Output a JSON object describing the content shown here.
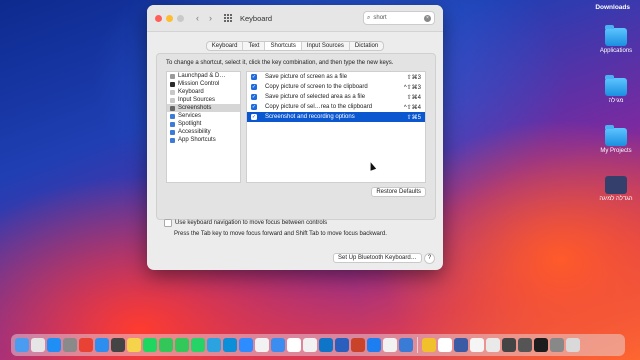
{
  "desktop": {
    "downloads_label": "Downloads",
    "icons": [
      {
        "label": "Applications",
        "color": "#4fb0ff"
      },
      {
        "label": "מגילה",
        "color": "#4fb0ff"
      },
      {
        "label": "My Projects",
        "color": "#4fb0ff"
      },
      {
        "label": "הגדלה למיגה",
        "color": "#34406b"
      }
    ]
  },
  "window": {
    "title": "Keyboard",
    "search_value": "short",
    "tabs": [
      {
        "label": "Keyboard",
        "active": false
      },
      {
        "label": "Text",
        "active": false
      },
      {
        "label": "Shortcuts",
        "active": true
      },
      {
        "label": "Input Sources",
        "active": false
      },
      {
        "label": "Dictation",
        "active": false
      }
    ],
    "instruction": "To change a shortcut, select it, click the key combination, and then type the new keys.",
    "categories": [
      {
        "label": "Launchpad & D…",
        "selected": false,
        "icon_color": "#9a9a9a"
      },
      {
        "label": "Mission Control",
        "selected": false,
        "icon_color": "#2b2b2b"
      },
      {
        "label": "Keyboard",
        "selected": false,
        "icon_color": "#c8c8c8"
      },
      {
        "label": "Input Sources",
        "selected": false,
        "icon_color": "#c8c8c8"
      },
      {
        "label": "Screenshots",
        "selected": true,
        "icon_color": "#666666"
      },
      {
        "label": "Services",
        "selected": false,
        "icon_color": "#3e7bd8"
      },
      {
        "label": "Spotlight",
        "selected": false,
        "icon_color": "#3e7bd8"
      },
      {
        "label": "Accessibility",
        "selected": false,
        "icon_color": "#3e7bd8"
      },
      {
        "label": "App Shortcuts",
        "selected": false,
        "icon_color": "#3e7bd8"
      }
    ],
    "shortcuts": [
      {
        "label": "Save picture of screen as a file",
        "keys": "⇧⌘3",
        "checked": true,
        "selected": false
      },
      {
        "label": "Copy picture of screen to the clipboard",
        "keys": "^⇧⌘3",
        "checked": true,
        "selected": false
      },
      {
        "label": "Save picture of selected area as a file",
        "keys": "⇧⌘4",
        "checked": true,
        "selected": false
      },
      {
        "label": "Copy picture of sel…rea to the clipboard",
        "keys": "^⇧⌘4",
        "checked": true,
        "selected": false
      },
      {
        "label": "Screenshot and recording options",
        "keys": "⇧⌘5",
        "checked": true,
        "selected": true
      }
    ],
    "restore_defaults_label": "Restore Defaults",
    "keyboard_nav_label": "Use keyboard navigation to move focus between controls",
    "keyboard_nav_hint": "Press the Tab key to move focus forward and Shift Tab to move focus backward.",
    "bluetooth_label": "Set Up Bluetooth Keyboard…",
    "help_label": "?"
  },
  "dock": {
    "apps": [
      "Finder",
      "Launchpad",
      "App Store",
      "System Preferences",
      "Chrome",
      "Safari",
      "Calculator",
      "Notes",
      "Spotify",
      "FaceTime",
      "Messages",
      "WhatsApp",
      "Telegram",
      "Skype",
      "Zoom",
      "Photos",
      "Mail",
      "Calendar",
      "Reminders",
      "VS Code",
      "Word",
      "PowerPoint",
      "Xcode",
      "TextEdit",
      "Preview"
    ],
    "colors": [
      "#4a9cf0",
      "#e6e6e6",
      "#1f8ff5",
      "#8a8a8a",
      "#e84235",
      "#2e8ef0",
      "#444444",
      "#f5d34a",
      "#1ed760",
      "#33c759",
      "#32c95a",
      "#25d366",
      "#2aa3e0",
      "#0a8fd8",
      "#2d8cff",
      "#f2f2f2",
      "#3b8ef0",
      "#ffffff",
      "#f2f2f2",
      "#0e75c8",
      "#2b5fbd",
      "#c9432a",
      "#1c7ef0",
      "#f2f2f2",
      "#3a7bd5"
    ],
    "right_colors": [
      "#f0c12a",
      "#ffffff",
      "#3b5ba5",
      "#f5f5f5",
      "#e9e9e9",
      "#444444",
      "#555555",
      "#1d1d1d",
      "#888888"
    ]
  }
}
